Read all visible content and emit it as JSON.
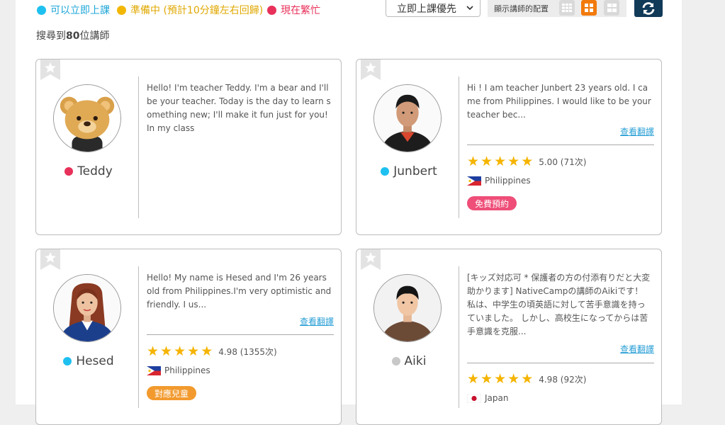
{
  "legend": [
    {
      "label": "可以立即上課",
      "color": "#1ec0f0"
    },
    {
      "label": "準備中 (預計10分鐘左右回歸)",
      "color": "#f2b705",
      "text_color": "#e0a800"
    },
    {
      "label": "現在繁忙",
      "color": "#e8315a",
      "text_color": "#e8315a"
    }
  ],
  "sort": {
    "selected": "立即上課優先"
  },
  "layout": {
    "label": "顯示講師的配置",
    "active": "large-grid"
  },
  "results": {
    "prefix": "搜尋到",
    "count": "80",
    "suffix": "位講師"
  },
  "teachers": [
    {
      "name": "Teddy",
      "status_color": "#e8315a",
      "intro": "Hello! I'm teacher Teddy. I'm a bear and I'll be your teacher. Today is the day to learn something new; I'll make it fun just for you! In my class",
      "translate": "",
      "rating": "",
      "reviews": "",
      "country": "",
      "badge": "",
      "flag_icon": "",
      "avatar_icon": "bear-avatar-icon"
    },
    {
      "name": "Junbert",
      "status_color": "#1ec0f0",
      "intro": "Hi ! I am teacher Junbert 23 years old. I came from Philippines. I would like to be your teacher bec...",
      "translate": "查看翻譯",
      "rating": "5.00",
      "reviews": "(71次)",
      "country": "Philippines",
      "badge": "免費預約",
      "badge_color": "#ee4e78",
      "flag_icon": "philippines-flag-icon",
      "avatar_icon": "teacher-photo-icon"
    },
    {
      "name": "Hesed",
      "status_color": "#1ec0f0",
      "intro": "Hello! My name is Hesed and I'm 26 years old from Philippines.I'm very optimistic and friendly. I us...",
      "translate": "查看翻譯",
      "rating": "4.98",
      "reviews": "(1355次)",
      "country": "Philippines",
      "badge": "對應兒童",
      "badge_color": "#f29a2e",
      "flag_icon": "philippines-flag-icon",
      "avatar_icon": "teacher-photo-icon"
    },
    {
      "name": "Aiki",
      "status_color": "#c8c8c8",
      "intro": "[キッズ対応可 * 保護者の方の付添有りだと大変助かります] NativeCampの講師のAikiです！ 私は、中学生の頃英語に対して苦手意識を持っていました。 しかし、高校生になってからは苦手意識を克服...",
      "translate": "查看翻譯",
      "rating": "4.98",
      "reviews": "(92次)",
      "country": "Japan",
      "badge": "",
      "flag_icon": "japan-flag-icon",
      "avatar_icon": "teacher-photo-icon"
    }
  ],
  "star_glyph": "★"
}
